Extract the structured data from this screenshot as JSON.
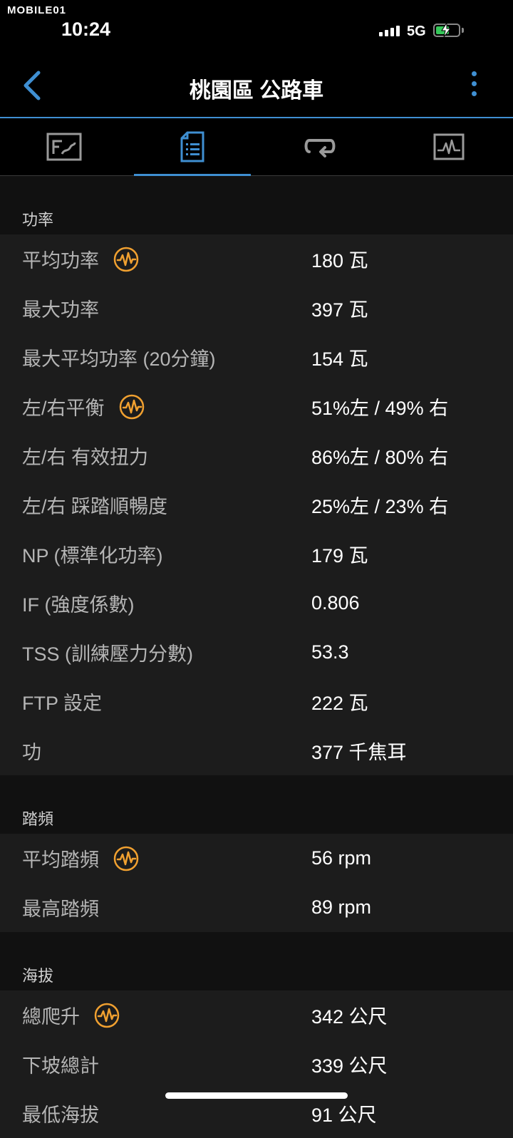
{
  "status_bar": {
    "watermark": "MOBILE01",
    "time": "10:24",
    "network": "5G"
  },
  "header": {
    "title": "桃園區 公路車"
  },
  "tabs": [
    {
      "icon": "map-stats-icon",
      "active": false
    },
    {
      "icon": "document-list-icon",
      "active": true
    },
    {
      "icon": "laps-repeat-icon",
      "active": false
    },
    {
      "icon": "chart-graph-icon",
      "active": false
    }
  ],
  "sections": [
    {
      "title": "功率",
      "rows": [
        {
          "label": "平均功率",
          "value": "180 瓦",
          "badge": "power-meter-icon"
        },
        {
          "label": "最大功率",
          "value": "397 瓦"
        },
        {
          "label": "最大平均功率 (20分鐘)",
          "value": "154 瓦"
        },
        {
          "label": "左/右平衡",
          "value": "51%左 / 49% 右",
          "badge": "power-meter-icon"
        },
        {
          "label": "左/右 有效扭力",
          "value": "86%左 / 80% 右"
        },
        {
          "label": "左/右 踩踏順暢度",
          "value": "25%左 / 23% 右"
        },
        {
          "label": "NP (標準化功率)",
          "value": "179 瓦"
        },
        {
          "label": "IF (強度係數)",
          "value": "0.806"
        },
        {
          "label": "TSS (訓練壓力分數)",
          "value": "53.3"
        },
        {
          "label": "FTP 設定",
          "value": "222 瓦"
        },
        {
          "label": "功",
          "value": "377 千焦耳"
        }
      ]
    },
    {
      "title": "踏頻",
      "rows": [
        {
          "label": "平均踏頻",
          "value": "56 rpm",
          "badge": "power-meter-icon"
        },
        {
          "label": "最高踏頻",
          "value": "89 rpm"
        }
      ]
    },
    {
      "title": "海拔",
      "rows": [
        {
          "label": "總爬升",
          "value": "342 公尺",
          "badge": "power-meter-icon"
        },
        {
          "label": "下坡總計",
          "value": "339 公尺"
        },
        {
          "label": "最低海拔",
          "value": "91 公尺"
        }
      ]
    }
  ],
  "colors": {
    "accent": "#3f8fd2",
    "badge": "#f0a030",
    "background": "#111111",
    "row_background": "#1c1c1c"
  }
}
